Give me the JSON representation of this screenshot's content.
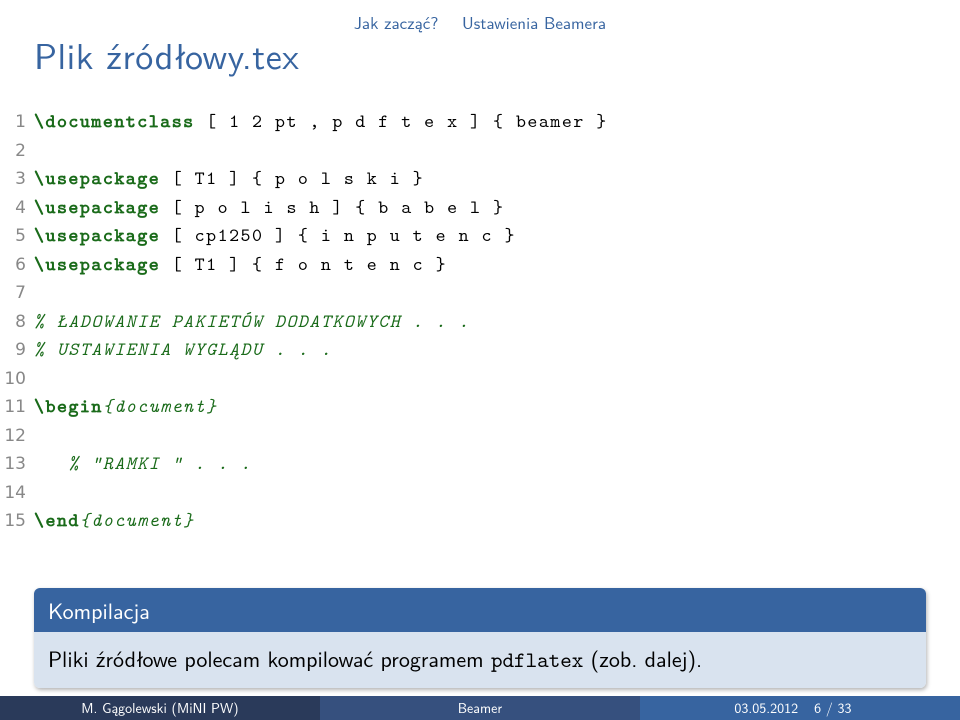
{
  "nav": {
    "section": "Jak zacząć?",
    "subsection": "Ustawienia Beamera"
  },
  "title": "Plik źródłowy.tex",
  "code": {
    "l1_a": "\\documentclass",
    "l1_b": " [ 1 2 pt , p d f t e x ] { beamer }",
    "l3_a": "\\usepackage",
    "l3_b": " [ T1 ] { p o l s k i }",
    "l4_a": "\\usepackage",
    "l4_b": " [ p o l i s h ] { b a b e l }",
    "l5_a": "\\usepackage",
    "l5_b": " [ cp1250 ] { i n p u t e n c }",
    "l6_a": "\\usepackage",
    "l6_b": " [ T1 ] { f o n t e n c }",
    "l8": "% ŁADOWANIE PAKIETÓW DODATKOWYCH . . .",
    "l9": "% USTAWIENIA WYGLĄDU . . .",
    "l11_a": "\\begin",
    "l11_b": "{document}",
    "l13": "   % \"RAMKI \" . . .",
    "l15_a": "\\end",
    "l15_b": "{document}"
  },
  "nums": [
    "1",
    "2",
    "3",
    "4",
    "5",
    "6",
    "7",
    "8",
    "9",
    "10",
    "11",
    "12",
    "13",
    "14",
    "15"
  ],
  "block": {
    "title": "Kompilacja",
    "body_a": "Pliki źródłowe polecam kompilować programem ",
    "body_code": "pdflatex",
    "body_b": " (zob. dalej)."
  },
  "footer": {
    "author": "M. Gągolewski (MiNI PW)",
    "short": "Beamer",
    "date": "03.05.2012",
    "page": "6 / 33"
  }
}
